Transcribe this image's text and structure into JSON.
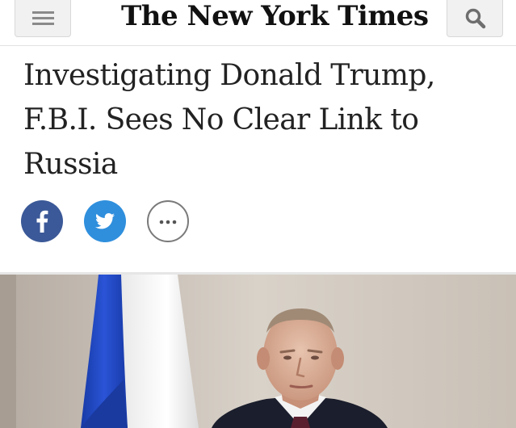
{
  "header": {
    "logo_text": "The New York Times",
    "menu_icon": "hamburger-menu-icon",
    "search_icon": "search-icon"
  },
  "article": {
    "headline_lines": [
      "Investigating Donald Trump,",
      "F.B.I. Sees No Clear Link to",
      "Russia"
    ]
  },
  "share": {
    "icons": [
      "facebook-icon",
      "twitter-icon",
      "more-options-icon"
    ]
  },
  "photo": {
    "description": "lead-photo"
  },
  "colors": {
    "facebook": "#3b5998",
    "twitter": "#2f8fdd",
    "headline": "#222222",
    "flag_blue": "#1d3fb8",
    "flag_white": "#f4f4f4"
  }
}
